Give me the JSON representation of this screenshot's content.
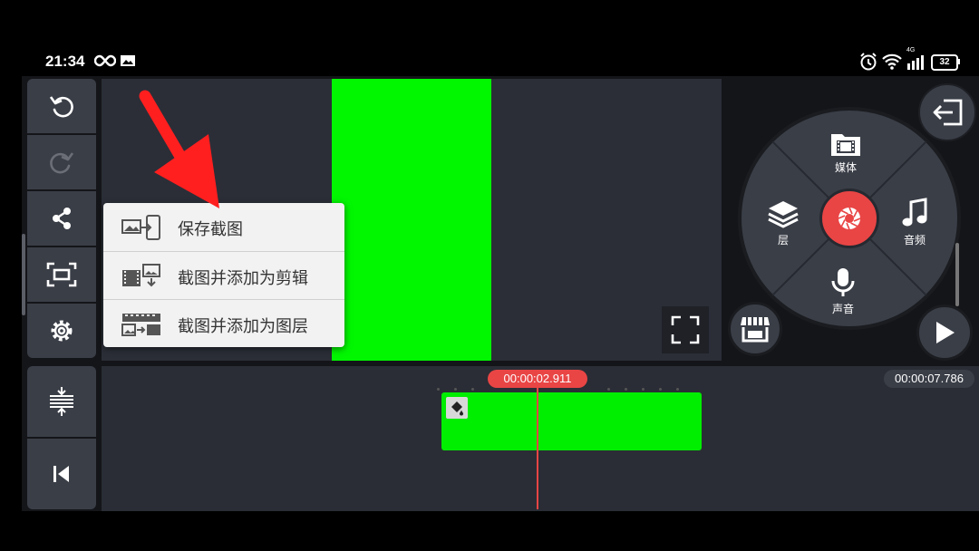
{
  "status_bar": {
    "time": "21:34",
    "battery": "32",
    "network": "4G"
  },
  "popup_menu": {
    "items": [
      {
        "label": "保存截图",
        "icon": "save-snapshot-icon"
      },
      {
        "label": "截图并添加为剪辑",
        "icon": "snapshot-add-clip-icon"
      },
      {
        "label": "截图并添加为图层",
        "icon": "snapshot-add-layer-icon"
      }
    ]
  },
  "media_wheel": {
    "media_label": "媒体",
    "audio_label": "音频",
    "voice_label": "声音",
    "layer_label": "层"
  },
  "timeline": {
    "current_time": "00:00:02.911",
    "total_time": "00:00:07.786"
  },
  "colors": {
    "accent_red": "#e94545",
    "chroma_green": "#00f700",
    "panel_gray": "#3a3e47"
  }
}
